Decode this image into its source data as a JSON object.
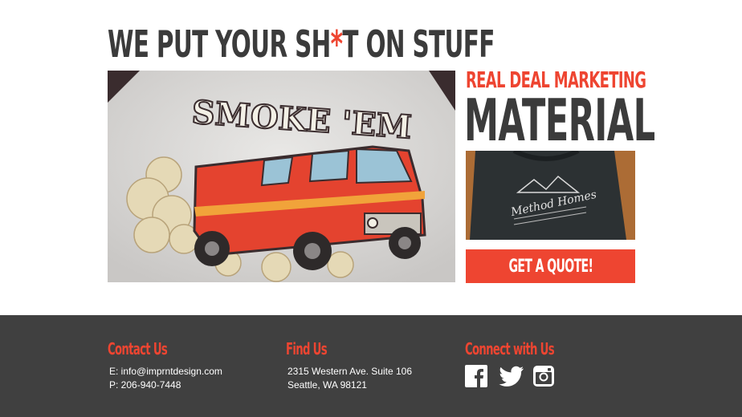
{
  "hero": {
    "headline_before": "WE PUT YOUR SH",
    "headline_star": "*",
    "headline_after": "T ON STUFF",
    "image_text": "SMOKE 'EM"
  },
  "sidebar": {
    "tagline_small": "REAL DEAL MARKETING",
    "tagline_big": "MATERIAL",
    "photo_text": "Method Homes",
    "quote_button": "GET A QUOTE!"
  },
  "footer": {
    "contact": {
      "heading": "Contact Us",
      "email": "E: info@imprntdesign.com",
      "phone": "P: 206-940-7448"
    },
    "find": {
      "heading": "Find Us",
      "address1": "2315 Western Ave. Suite 106",
      "address2": "Seattle, WA 98121"
    },
    "connect": {
      "heading": "Connect with Us",
      "icons": [
        "facebook-icon",
        "twitter-icon",
        "instagram-icon"
      ]
    }
  },
  "colors": {
    "accent": "#ee4531",
    "dark_text": "#3b3b3b",
    "footer_bg": "#404040"
  }
}
